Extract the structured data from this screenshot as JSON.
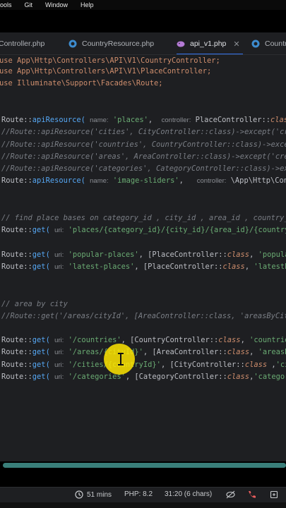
{
  "menu": [
    "ools",
    "Git",
    "Window",
    "Help"
  ],
  "tabs": [
    {
      "label": "Controller.php",
      "icon": "php-file-icon"
    },
    {
      "label": "CountryResource.php",
      "icon": "php-class-icon"
    },
    {
      "label": "api_v1.php",
      "icon": "php-elephant-icon",
      "active": true
    },
    {
      "label": "Country",
      "icon": "php-class-icon"
    }
  ],
  "code": {
    "l1": "use App\\Http\\Controllers\\API\\V1\\CountryController;",
    "l2": "use App\\Http\\Controllers\\API\\V1\\PlaceController;",
    "l3": "use Illuminate\\Support\\Facades\\Route;",
    "route": "Route::",
    "apiResource": "apiResource(",
    "get": "get(",
    "hint_name": "name:",
    "hint_controller": "controller:",
    "hint_uri": "uri:",
    "places_str": "'places'",
    "places_ctrl": "PlaceController::",
    "class_kw": "class",
    "places_tail": ")->",
    "c1": "//Route::apiResource('cities', CityController::class)->except('crea",
    "c2": "//Route::apiResource('countries', CountryController::class)->except",
    "c3": "//Route::apiResource('areas', AreaController::class)->except('creat",
    "c4": "//Route::apiResource('categories', CategoryController::class)->exce",
    "img_str": "'image-sliders'",
    "img_ctrl": "\\App\\Http\\Contro",
    "c5": "// find place bases on category_id , city_id , area_id , country_id",
    "r_places_str": "'places/{category_id}/{city_id}/{area_id}/{country_i",
    "popular_str": "'popular-places'",
    "popular_ctrl": "[PlaceController::",
    "popular_tail": "'popularP",
    "latest_str": "'latest-places'",
    "latest_ctrl": "[PlaceController::",
    "latest_tail": "'latestPla",
    "c6": "// area by city",
    "c7": "//Route::get('/areas/cityId', [AreaController::class, 'areasByCityI",
    "countries_str": "'/countries'",
    "countries_ctrl": "[CountryController::",
    "countries_tail": "'countries'",
    "areas_str": "'/areas/{cityId}'",
    "areas_ctrl": "[AreaController::",
    "areas_tail": "'areasByC",
    "cities_str": "'/cities/{countryId}'",
    "cities_ctrl": "[CityController::",
    "cities_tail": "'citi",
    "categories_str": "'/categories'",
    "categories_ctrl": "[CategoryController::",
    "categories_tail": "'categorie"
  },
  "status": {
    "time": "51 mins",
    "php": "PHP: 8.2",
    "position": "31:20 (6 chars)"
  },
  "colors": {
    "keyword": "#cf8e6d",
    "function": "#56a8f5",
    "string": "#6aab73",
    "comment": "#7a7e85",
    "accent": "#3574f0",
    "cursor_highlight": "#ffe600"
  }
}
